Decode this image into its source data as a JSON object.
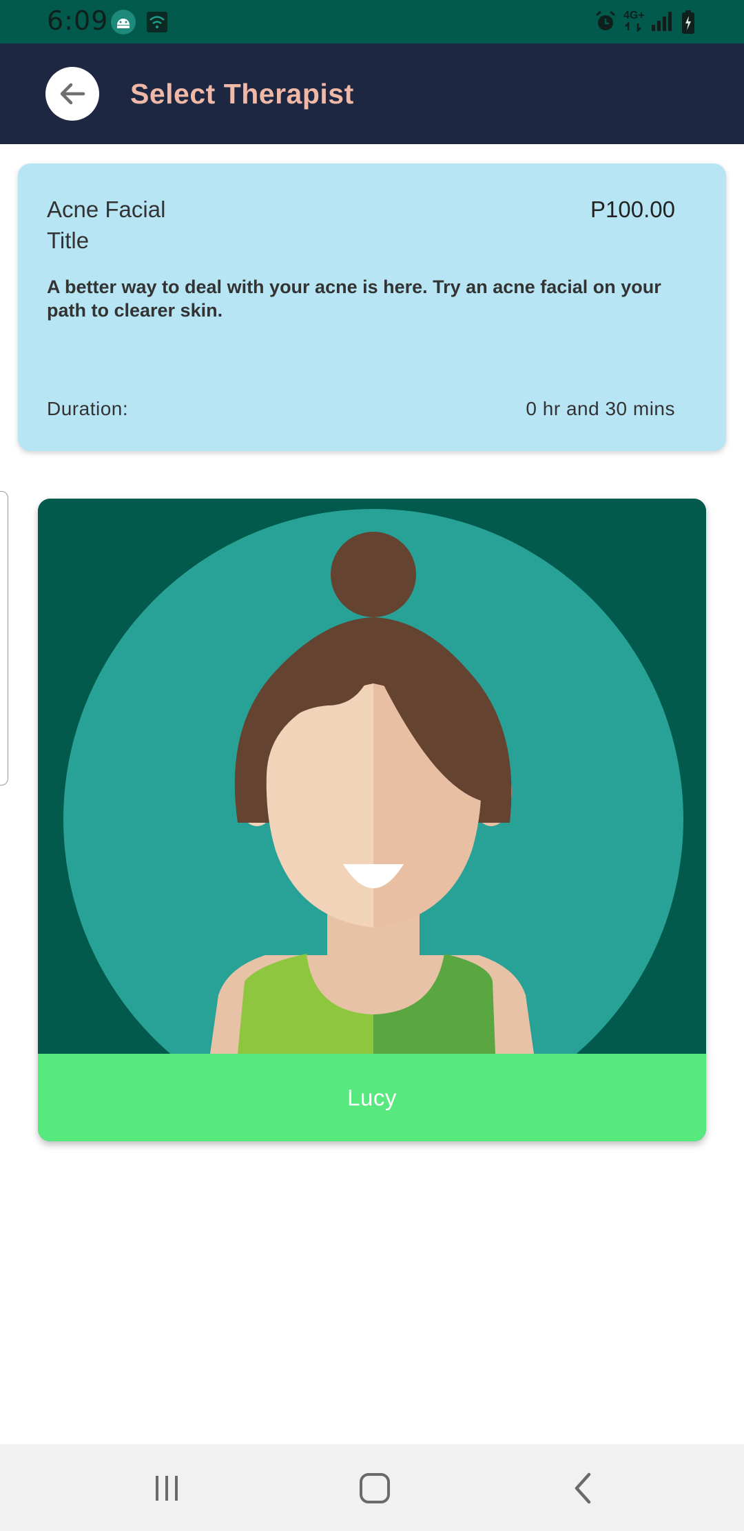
{
  "status_bar": {
    "time": "6:09",
    "network": "4G+",
    "icons": [
      "android-icon",
      "wifi-box-icon",
      "alarm-icon",
      "signal-icon",
      "battery-charging-icon"
    ]
  },
  "app_bar": {
    "title": "Select Therapist",
    "back_icon": "arrow-back-icon"
  },
  "service": {
    "name": "Acne Facial",
    "title": "Title",
    "price": "P100.00",
    "description": "A better way to deal with your acne is here. Try an acne facial on your path to clearer skin.",
    "duration_label": "Duration:",
    "duration_value": "0 hr and 30 mins"
  },
  "therapists": [
    {
      "name": "Lucy",
      "avatar": "female-avatar"
    }
  ],
  "nav_bar": {
    "buttons": [
      "recents-icon",
      "home-icon",
      "back-icon"
    ]
  },
  "colors": {
    "status_bar": "#025a4c",
    "app_bar": "#1e2742",
    "title": "#f0b8a6",
    "service_card": "#b7e5f4",
    "name_bar": "#57e87e",
    "avatar_bg": "#28a297"
  }
}
